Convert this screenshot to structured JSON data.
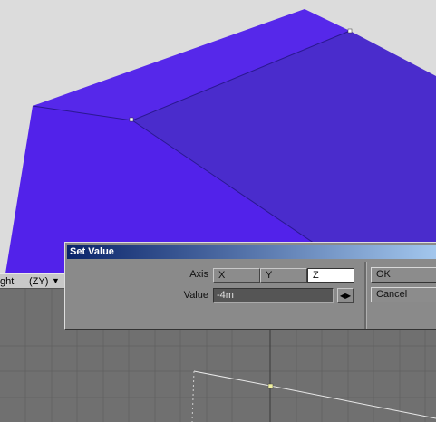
{
  "viewport": {
    "label": "ght",
    "axis": "(ZY)",
    "menu_icon": "chevron-down-icon"
  },
  "dialog": {
    "title": "Set Value",
    "axis_label": "Axis",
    "axis_options": [
      "X",
      "Y",
      "Z"
    ],
    "axis_selected": "Z",
    "value_label": "Value",
    "value": "-4m",
    "ok_label": "OK",
    "cancel_label": "Cancel"
  },
  "colors": {
    "shape_light": "#5222ea",
    "shape_dark": "#4a2ccc",
    "titlebar_start": "#0a246a",
    "titlebar_end": "#a6caf0",
    "ortho_background": "#707070",
    "dialog_background": "#8a8a8a"
  }
}
